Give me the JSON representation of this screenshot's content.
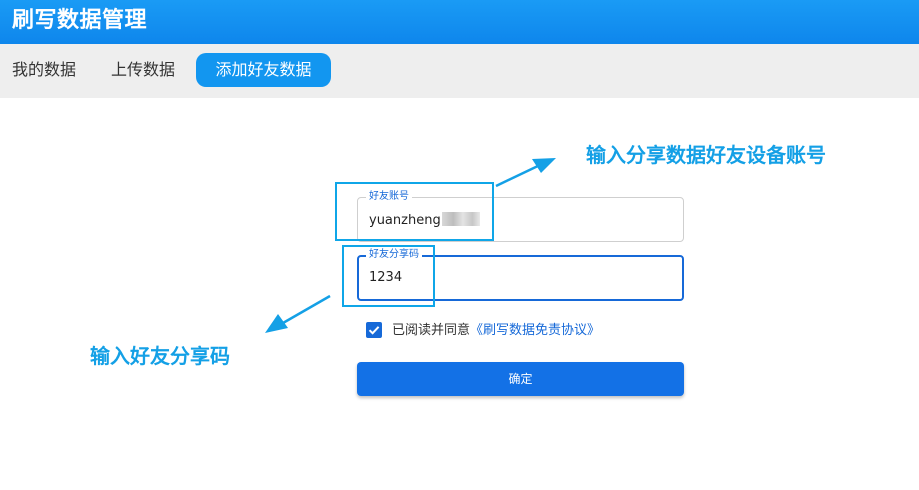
{
  "app": {
    "title": "刷写数据管理",
    "accent_color": "#1296f0"
  },
  "tabs": [
    {
      "label": "我的数据",
      "active": false
    },
    {
      "label": "上传数据",
      "active": false
    },
    {
      "label": "添加好友数据",
      "active": true
    }
  ],
  "form": {
    "account": {
      "label": "好友账号",
      "value": "yuanzheng"
    },
    "share_code": {
      "label": "好友分享码",
      "value": "1234"
    },
    "agreement": {
      "checked": true,
      "text": "已阅读并同意",
      "link": "《刷写数据免责协议》"
    },
    "confirm_label": "确定"
  },
  "annotations": {
    "account_hint": "输入分享数据好友设备账号",
    "code_hint": "输入好友分享码",
    "color": "#14a0e6"
  }
}
